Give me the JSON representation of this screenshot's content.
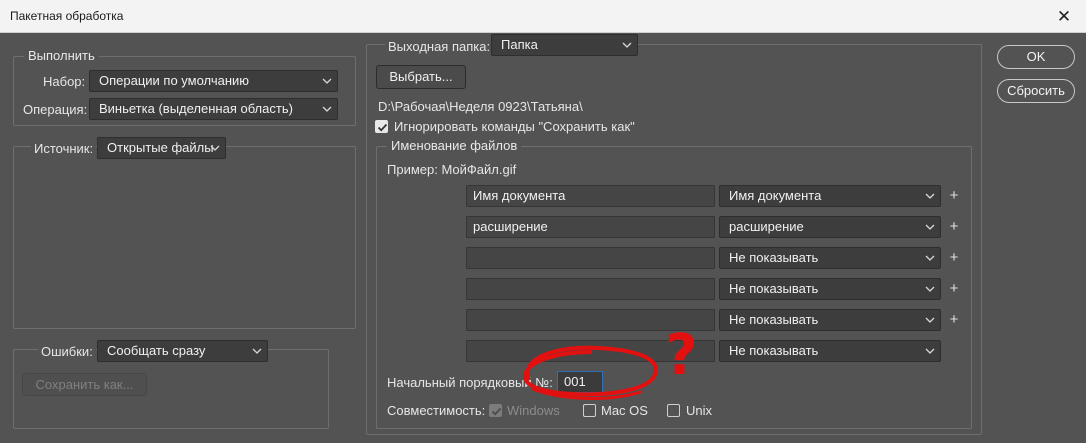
{
  "window": {
    "title": "Пакетная обработка",
    "close_icon": "✕"
  },
  "play": {
    "legend": "Выполнить",
    "set_label": "Набор:",
    "set_value": "Операции по умолчанию",
    "action_label": "Операция:",
    "action_value": "Виньетка (выделенная область)"
  },
  "source": {
    "label": "Источник:",
    "value": "Открытые файлы"
  },
  "errors": {
    "label": "Ошибки:",
    "value": "Сообщать сразу",
    "save_as_label": "Сохранить как..."
  },
  "destination": {
    "label": "Выходная папка:",
    "value": "Папка",
    "choose_label": "Выбрать...",
    "path": "D:\\Рабочая\\Неделя 0923\\Татьяна\\",
    "override_label": "Игнорировать команды \"Сохранить как\"",
    "override_checked": true
  },
  "naming": {
    "legend": "Именование файлов",
    "example": "Пример: МойФайл.gif",
    "rows": [
      {
        "text": "Имя документа",
        "select": "Имя документа",
        "plus": "+"
      },
      {
        "text": "расширение",
        "select": "расширение",
        "plus": "+"
      },
      {
        "text": "",
        "select": "Не показывать",
        "plus": "+"
      },
      {
        "text": "",
        "select": "Не показывать",
        "plus": "+"
      },
      {
        "text": "",
        "select": "Не показывать",
        "plus": "+"
      },
      {
        "text": "",
        "select": "Не показывать",
        "plus": ""
      }
    ],
    "serial_label": "Начальный порядковый №:",
    "serial_value": "001",
    "compat_label": "Совместимость:",
    "windows_label": "Windows",
    "mac_label": "Mac OS",
    "unix_label": "Unix"
  },
  "buttons": {
    "ok": "OK",
    "reset": "Сбросить"
  },
  "annotation": {
    "mark": "?",
    "color": "#e31010"
  }
}
